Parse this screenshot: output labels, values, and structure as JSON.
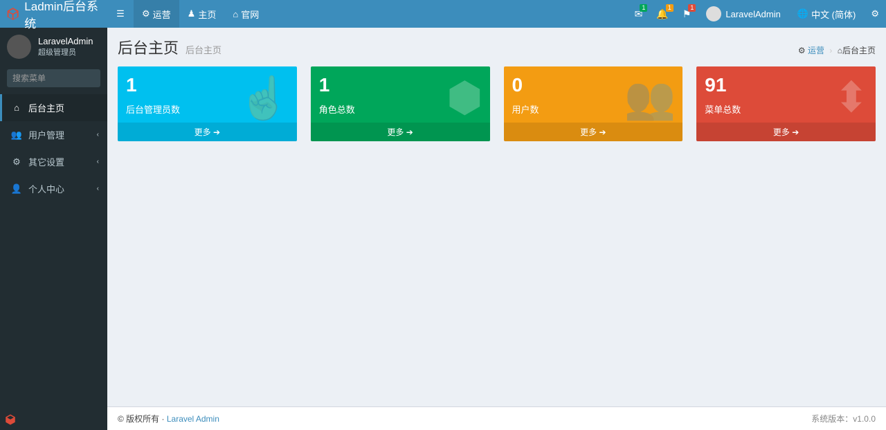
{
  "brand": "Ladmin后台系统",
  "topnav": {
    "ops": "运营",
    "home": "主页",
    "site": "官网"
  },
  "notifications": {
    "mail": "1",
    "bell": "1",
    "flag": "1"
  },
  "header_user": "LaravelAdmin",
  "language": "中文 (简体)",
  "user": {
    "name": "LaravelAdmin",
    "role": "超级管理员"
  },
  "search_placeholder": "搜索菜单",
  "menu": {
    "dashboard": "后台主页",
    "users": "用户管理",
    "settings": "其它设置",
    "profile": "个人中心"
  },
  "page": {
    "title": "后台主页",
    "subtitle": "后台主页"
  },
  "breadcrumb": {
    "level1": "运营",
    "level2": "后台主页"
  },
  "boxes": {
    "admins": {
      "number": "1",
      "label": "后台管理员数",
      "more": "更多"
    },
    "roles": {
      "number": "1",
      "label": "角色总数",
      "more": "更多"
    },
    "users": {
      "number": "0",
      "label": "用户数",
      "more": "更多"
    },
    "menus": {
      "number": "91",
      "label": "菜单总数",
      "more": "更多"
    }
  },
  "footer": {
    "copyright": "© 版权所有 · ",
    "link": "Laravel Admin",
    "version_label": "系统版本：",
    "version": "v1.0.0"
  }
}
